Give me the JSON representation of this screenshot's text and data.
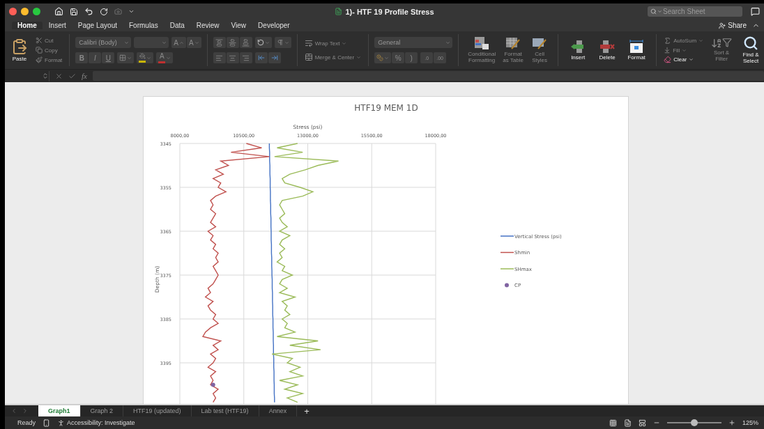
{
  "window": {
    "title": "1)- HTF 19 Profile Stress",
    "search": {
      "placeholder": "Search Sheet"
    },
    "share": "Share"
  },
  "ribbon_tabs": [
    {
      "label": "Home",
      "selected": true
    },
    {
      "label": "Insert",
      "selected": false
    },
    {
      "label": "Page Layout",
      "selected": false
    },
    {
      "label": "Formulas",
      "selected": false
    },
    {
      "label": "Data",
      "selected": false
    },
    {
      "label": "Review",
      "selected": false
    },
    {
      "label": "View",
      "selected": false
    },
    {
      "label": "Developer",
      "selected": false
    }
  ],
  "ribbon": {
    "clipboard": {
      "paste": "Paste",
      "items": [
        {
          "kind": "cut",
          "label": "Cut",
          "disabled": true
        },
        {
          "kind": "copy",
          "label": "Copy",
          "disabled": true
        },
        {
          "kind": "format",
          "label": "Format",
          "disabled": true
        }
      ]
    },
    "font": {
      "font_name": "Calibri (Body)",
      "grow": "A",
      "shrink": "A",
      "styles": [
        "B",
        "I",
        "U"
      ],
      "font_color": "A"
    },
    "alignment": {
      "wrap_text": "Wrap Text",
      "merge": "Merge & Center"
    },
    "number": {
      "format": "General",
      "percent": "%",
      "comma": ")",
      "decimals": [
        ".0",
        ".00"
      ]
    },
    "cells": [
      {
        "kind": "conditional",
        "label": "Conditional Formatting",
        "disabled": true
      },
      {
        "kind": "table",
        "label": "Format as Table",
        "disabled": true
      },
      {
        "kind": "styles",
        "label": "Cell Styles",
        "disabled": true
      },
      {
        "kind": "insert",
        "label": "Insert",
        "disabled": false
      },
      {
        "kind": "delete",
        "label": "Delete",
        "disabled": false
      },
      {
        "kind": "format",
        "label": "Format",
        "disabled": false
      }
    ],
    "editing": {
      "small": [
        {
          "kind": "autosum",
          "label": "AutoSum",
          "disabled": true
        },
        {
          "kind": "fill",
          "label": "Fill",
          "disabled": true
        },
        {
          "kind": "clear",
          "label": "Clear",
          "disabled": false
        }
      ],
      "large": [
        {
          "kind": "sort",
          "label": "Sort & Filter",
          "disabled": true
        },
        {
          "kind": "find",
          "label": "Find & Select",
          "disabled": false
        }
      ]
    }
  },
  "formula_bar": {
    "fx": "fx"
  },
  "chart": {
    "chart_data": {
      "type": "line",
      "orientation": "horizontal",
      "title": "HTF19 MEM 1D",
      "xlabel": "Stress (psi)",
      "ylabel": "Depth (m)",
      "grid": true,
      "legend": true,
      "x": [
        3345,
        3346,
        3347,
        3348,
        3349,
        3350,
        3351,
        3352,
        3353,
        3354,
        3355,
        3356,
        3357,
        3358,
        3359,
        3360,
        3361,
        3362,
        3363,
        3364,
        3365,
        3366,
        3367,
        3368,
        3369,
        3370,
        3371,
        3372,
        3373,
        3374,
        3375,
        3376,
        3377,
        3378,
        3379,
        3380,
        3381,
        3382,
        3383,
        3384,
        3385,
        3386,
        3387,
        3388,
        3389,
        3390,
        3391,
        3392,
        3393,
        3394,
        3395,
        3396,
        3397,
        3398,
        3399,
        3400,
        3401,
        3402,
        3403,
        3404
      ],
      "xlim": [
        8000,
        18000
      ],
      "ylim": [
        3405,
        3345
      ],
      "xticks": [
        {
          "value": 8000,
          "label": "8000,00"
        },
        {
          "value": 10500,
          "label": "10500,00"
        },
        {
          "value": 13000,
          "label": "13000,00"
        },
        {
          "value": 15500,
          "label": "15500,00"
        },
        {
          "value": 18000,
          "label": "18000,00"
        }
      ],
      "yticks": [
        3345,
        3355,
        3365,
        3375,
        3385,
        3395
      ],
      "series": [
        {
          "name": "Vertical Stress (psi)",
          "color": "#4472c4",
          "values": [
            11500,
            11500,
            11510,
            11510,
            11510,
            11520,
            11520,
            11520,
            11530,
            11530,
            11530,
            11540,
            11540,
            11540,
            11550,
            11550,
            11550,
            11560,
            11560,
            11560,
            11570,
            11570,
            11570,
            11580,
            11580,
            11580,
            11590,
            11590,
            11590,
            11600,
            11600,
            11610,
            11610,
            11610,
            11620,
            11620,
            11620,
            11630,
            11630,
            11630,
            11640,
            11640,
            11640,
            11650,
            11650,
            11650,
            11660,
            11660,
            11660,
            11670,
            11670,
            11670,
            11680,
            11680,
            11680,
            11690,
            11690,
            11690,
            11700,
            11700
          ]
        },
        {
          "name": "Shmin",
          "color": "#c0504d",
          "values": [
            10600,
            11200,
            10000,
            11500,
            9600,
            9900,
            9400,
            9700,
            9300,
            9600,
            9500,
            9800,
            9400,
            9200,
            9300,
            9200,
            9400,
            9300,
            9200,
            9400,
            9100,
            9300,
            9200,
            9400,
            9300,
            9500,
            9400,
            9500,
            9300,
            9400,
            9500,
            9400,
            9300,
            9100,
            9200,
            9000,
            9300,
            9100,
            9200,
            9400,
            9300,
            9500,
            9200,
            9000,
            8900,
            9600,
            9300,
            9500,
            9200,
            9400,
            9300,
            9100,
            9400,
            9200,
            9300,
            9200,
            9500,
            9300,
            9400,
            9300
          ]
        },
        {
          "name": "SHmax",
          "color": "#9bbb59",
          "values": [
            12600,
            11800,
            12800,
            11700,
            14200,
            13400,
            12900,
            12300,
            12000,
            12100,
            12700,
            13200,
            12800,
            12000,
            11900,
            12000,
            12100,
            11900,
            12000,
            12200,
            11900,
            12300,
            12000,
            11900,
            12100,
            11900,
            12000,
            11800,
            12100,
            12000,
            12400,
            12000,
            11900,
            12200,
            11900,
            12500,
            12000,
            12200,
            12100,
            12300,
            12000,
            12200,
            12100,
            12500,
            11800,
            13400,
            12300,
            13500,
            11600,
            12400,
            12200,
            12700,
            12300,
            12800,
            11900,
            12600,
            12100,
            12800,
            12200,
            12600
          ]
        },
        {
          "name": "CP",
          "color": "#8064a2",
          "marker": true,
          "values": [
            null,
            null,
            null,
            null,
            null,
            null,
            null,
            null,
            null,
            null,
            null,
            null,
            null,
            null,
            null,
            null,
            null,
            null,
            null,
            null,
            null,
            null,
            null,
            null,
            null,
            null,
            null,
            null,
            null,
            null,
            null,
            null,
            null,
            null,
            null,
            null,
            null,
            null,
            null,
            null,
            null,
            null,
            null,
            null,
            null,
            null,
            null,
            null,
            null,
            null,
            null,
            null,
            null,
            null,
            null,
            9300,
            null,
            null,
            null,
            null
          ]
        }
      ]
    }
  },
  "sheet_tabs": [
    {
      "label": "Graph1",
      "selected": true
    },
    {
      "label": "Graph 2",
      "selected": false
    },
    {
      "label": "HTF19 (updated)",
      "selected": false
    },
    {
      "label": "Lab test (HTF19)",
      "selected": false
    },
    {
      "label": "Annex",
      "selected": false
    }
  ],
  "add_sheet": "+",
  "status_bar": {
    "mode": "Ready",
    "accessibility": "Accessibility: Investigate",
    "zoom": {
      "level": 0.5,
      "label": "125%"
    }
  }
}
